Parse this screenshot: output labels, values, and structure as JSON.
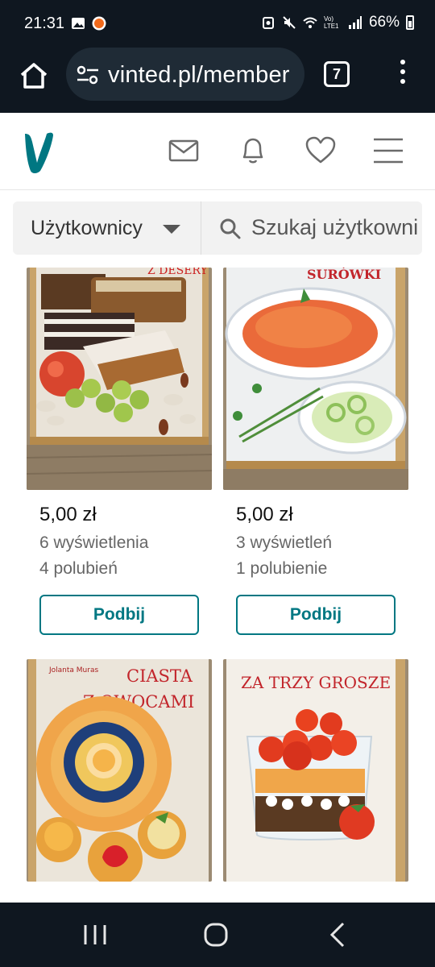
{
  "status_bar": {
    "time": "21:31",
    "left_icons": [
      "gallery-icon",
      "notification-dot-icon"
    ],
    "right_icons": [
      "alarm-icon",
      "mute-icon",
      "wifi-icon",
      "volte-icon",
      "signal-icon"
    ],
    "volte_label": "Vo) LTE1",
    "battery": "66%"
  },
  "browser": {
    "url": "vinted.pl/member",
    "tabs_count": "7"
  },
  "header": {
    "logo_letter": "V",
    "accent": "#007782",
    "icons": [
      "mail-icon",
      "bell-icon",
      "heart-icon",
      "hamburger-menu-icon"
    ]
  },
  "search": {
    "filter_value": "Użytkownicy",
    "placeholder": "Szukaj użytkowników"
  },
  "items": [
    {
      "image_label": "Z DESERY",
      "price": "5,00 zł",
      "views": "6 wyświetlenia",
      "likes": "4 polubień",
      "button": "Podbij"
    },
    {
      "image_label": "SURÓWKI",
      "price": "5,00 zł",
      "views": "3 wyświetleń",
      "likes": "1 polubienie",
      "button": "Podbij"
    },
    {
      "image_author": "Jolanta Muras",
      "image_label_line1": "CIASTA",
      "image_label_line2": "Z OWOCAMI"
    },
    {
      "image_label": "ZA TRZY GROSZE"
    }
  ]
}
